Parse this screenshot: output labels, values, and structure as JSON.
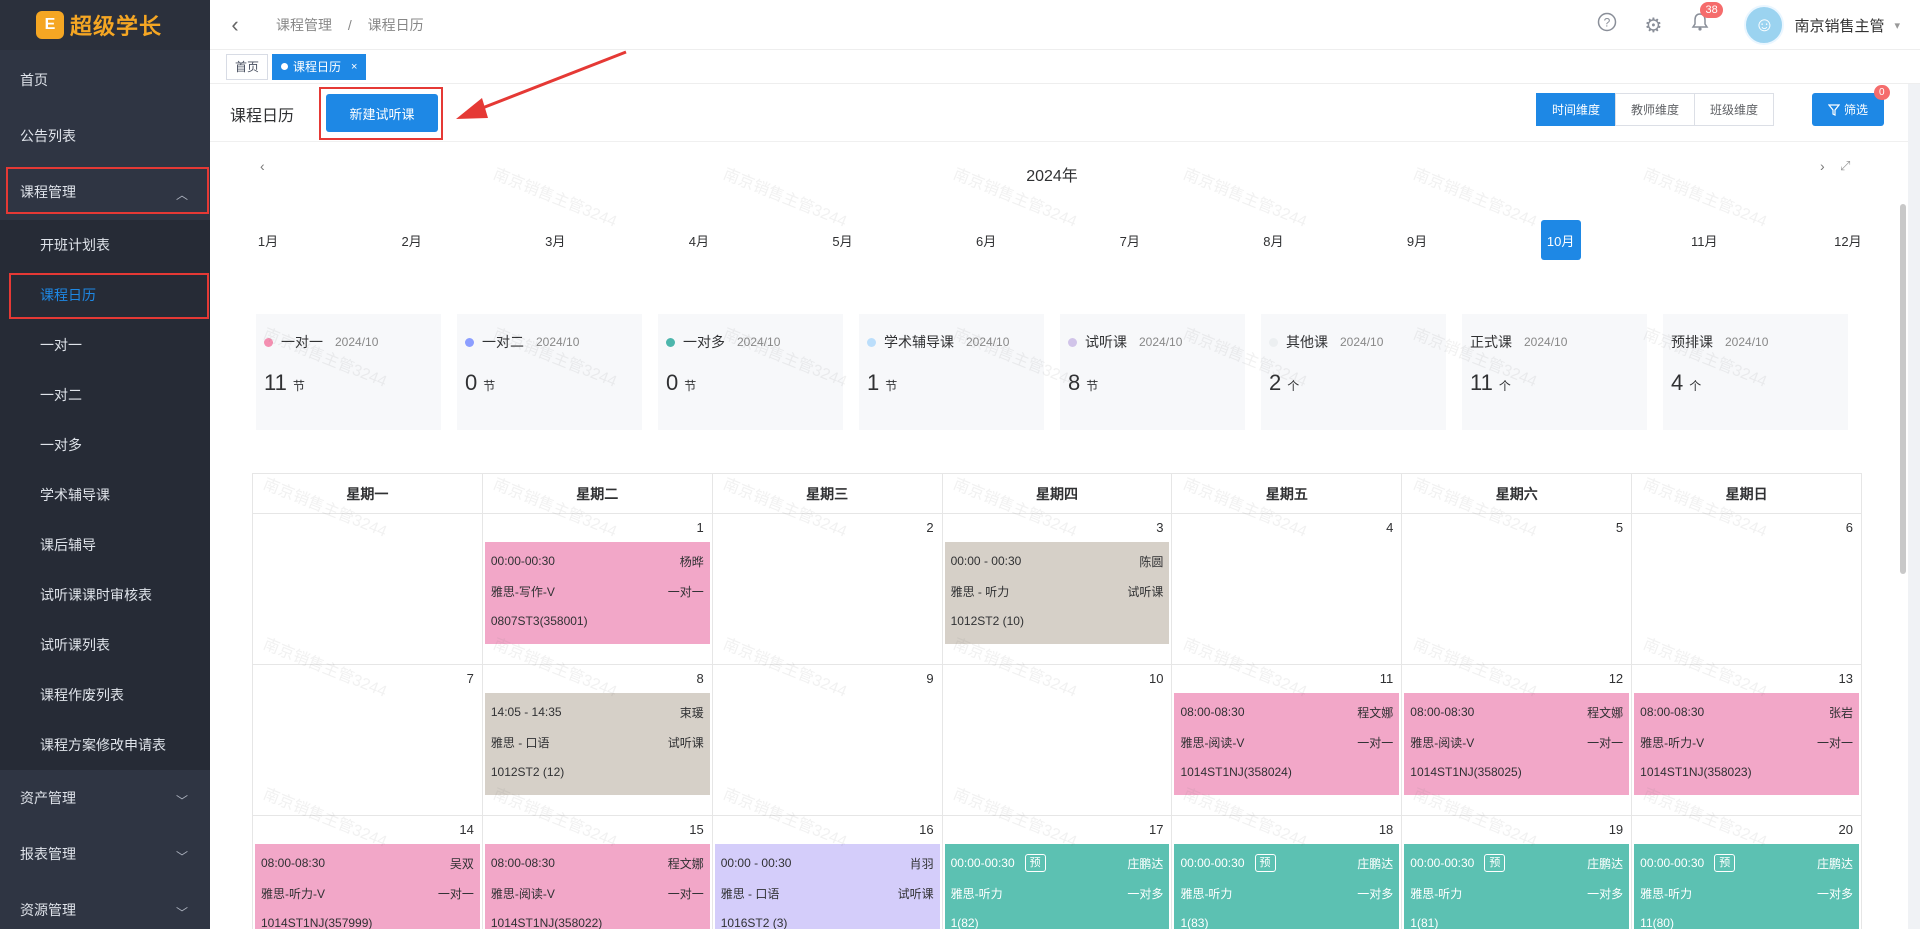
{
  "logo": {
    "mark": "E",
    "text": "超级学长"
  },
  "sidebar": {
    "items": [
      {
        "label": "首页"
      },
      {
        "label": "公告列表"
      },
      {
        "label": "课程管理",
        "chevron": "︿"
      },
      {
        "label": "资产管理",
        "chevron": "﹀"
      },
      {
        "label": "报表管理",
        "chevron": "﹀"
      },
      {
        "label": "资源管理",
        "chevron": "﹀"
      }
    ],
    "sub_items": [
      {
        "label": "开班计划表"
      },
      {
        "label": "课程日历"
      },
      {
        "label": "一对一"
      },
      {
        "label": "一对二"
      },
      {
        "label": "一对多"
      },
      {
        "label": "学术辅导课"
      },
      {
        "label": "课后辅导"
      },
      {
        "label": "试听课课时审核表"
      },
      {
        "label": "试听课列表"
      },
      {
        "label": "课程作废列表"
      },
      {
        "label": "课程方案修改申请表"
      }
    ]
  },
  "header": {
    "back": "‹",
    "crumbs": [
      "课程管理",
      "/",
      "课程日历"
    ],
    "icons": {
      "help": "?",
      "settings": "⚙",
      "bell": "🔔"
    },
    "bell_count": "38",
    "user_name": "南京销售主管",
    "user_chev": "▾"
  },
  "tags": {
    "home": "首页",
    "active": "课程日历",
    "close": "×"
  },
  "page": {
    "title": "课程日历",
    "new_button": "新建试听课",
    "dims": [
      "时间维度",
      "教师维度",
      "班级维度"
    ],
    "filter": "筛选",
    "filter_badge": "0",
    "year": "2024年",
    "prev": "‹",
    "next": "›",
    "fullscreen": "⤢",
    "months": [
      "1月",
      "2月",
      "3月",
      "4月",
      "5月",
      "6月",
      "7月",
      "8月",
      "9月",
      "10月",
      "11月",
      "12月"
    ],
    "active_month": "10月"
  },
  "stats": [
    {
      "label": "一对一",
      "date": "2024/10",
      "value": "11",
      "unit": "节",
      "color": "#f48fb1"
    },
    {
      "label": "一对二",
      "date": "2024/10",
      "value": "0",
      "unit": "节",
      "color": "#8c9eff"
    },
    {
      "label": "一对多",
      "date": "2024/10",
      "value": "0",
      "unit": "节",
      "color": "#4db6ac"
    },
    {
      "label": "学术辅导课",
      "date": "2024/10",
      "value": "1",
      "unit": "节",
      "color": "#bbdefb"
    },
    {
      "label": "试听课",
      "date": "2024/10",
      "value": "8",
      "unit": "节",
      "color": "#d1c4e9"
    },
    {
      "label": "其他课",
      "date": "2024/10",
      "value": "2",
      "unit": "个",
      "color": "#eceff1"
    },
    {
      "label": "正式课",
      "date": "2024/10",
      "value": "11",
      "unit": "个",
      "color": ""
    },
    {
      "label": "预排课",
      "date": "2024/10",
      "value": "4",
      "unit": "个",
      "color": ""
    }
  ],
  "calendar": {
    "weekdays": [
      "星期一",
      "星期二",
      "星期三",
      "星期四",
      "星期五",
      "星期六",
      "星期日"
    ],
    "rows": [
      [
        {
          "day": ""
        },
        {
          "day": "1",
          "ev": {
            "color": "#f2a7c8",
            "time": "00:00-00:30",
            "teacher": "杨晔",
            "course": "雅思-写作-V",
            "type": "一对一",
            "code": "0807ST3(358001)"
          }
        },
        {
          "day": "2"
        },
        {
          "day": "3",
          "ev": {
            "color": "#d6d0c8",
            "time": "00:00 - 00:30",
            "teacher": "陈圆",
            "course": "雅思 - 听力",
            "type": "试听课",
            "code": "1012ST2 (10)"
          }
        },
        {
          "day": "4"
        },
        {
          "day": "5"
        },
        {
          "day": "6"
        }
      ],
      [
        {
          "day": "7"
        },
        {
          "day": "8",
          "ev": {
            "color": "#d6d0c8",
            "time": "14:05 - 14:35",
            "teacher": "束瑗",
            "course": "雅思 - 口语",
            "type": "试听课",
            "code": "1012ST2 (12)"
          }
        },
        {
          "day": "9"
        },
        {
          "day": "10"
        },
        {
          "day": "11",
          "ev": {
            "color": "#f2a7c8",
            "time": "08:00-08:30",
            "teacher": "程文娜",
            "course": "雅思-阅读-V",
            "type": "一对一",
            "code": "1014ST1NJ(358024)"
          }
        },
        {
          "day": "12",
          "ev": {
            "color": "#f2a7c8",
            "time": "08:00-08:30",
            "teacher": "程文娜",
            "course": "雅思-阅读-V",
            "type": "一对一",
            "code": "1014ST1NJ(358025)"
          }
        },
        {
          "day": "13",
          "ev": {
            "color": "#f2a7c8",
            "time": "08:00-08:30",
            "teacher": "张岩",
            "course": "雅思-听力-V",
            "type": "一对一",
            "code": "1014ST1NJ(358023)"
          }
        }
      ],
      [
        {
          "day": "14",
          "ev": {
            "color": "#f2a7c8",
            "time": "08:00-08:30",
            "teacher": "吴双",
            "course": "雅思-听力-V",
            "type": "一对一",
            "code": "1014ST1NJ(357999)"
          }
        },
        {
          "day": "15",
          "ev": {
            "color": "#f2a7c8",
            "time": "08:00-08:30",
            "teacher": "程文娜",
            "course": "雅思-阅读-V",
            "type": "一对一",
            "code": "1014ST1NJ(358022)"
          }
        },
        {
          "day": "16",
          "ev": {
            "color": "#d4cdfa",
            "time": "00:00 - 00:30",
            "teacher": "肖羽",
            "course": "雅思 - 口语",
            "type": "试听课",
            "code": "1016ST2 (3)"
          }
        },
        {
          "day": "17",
          "ev": {
            "color": "#5cc1b2",
            "time": "00:00-00:30",
            "badge": "预",
            "teacher": "庄鹏达",
            "course": "雅思-听力",
            "type": "一对多",
            "code": "1(82)"
          }
        },
        {
          "day": "18",
          "ev": {
            "color": "#5cc1b2",
            "time": "00:00-00:30",
            "badge": "预",
            "teacher": "庄鹏达",
            "course": "雅思-听力",
            "type": "一对多",
            "code": "1(83)"
          }
        },
        {
          "day": "19",
          "ev": {
            "color": "#5cc1b2",
            "time": "00:00-00:30",
            "badge": "预",
            "teacher": "庄鹏达",
            "course": "雅思-听力",
            "type": "一对多",
            "code": "1(81)"
          }
        },
        {
          "day": "20",
          "ev": {
            "color": "#5cc1b2",
            "time": "00:00-00:30",
            "badge": "预",
            "teacher": "庄鹏达",
            "course": "雅思-听力",
            "type": "一对多",
            "code": "11(80)"
          }
        }
      ]
    ]
  },
  "watermark": "南京销售主管3244"
}
